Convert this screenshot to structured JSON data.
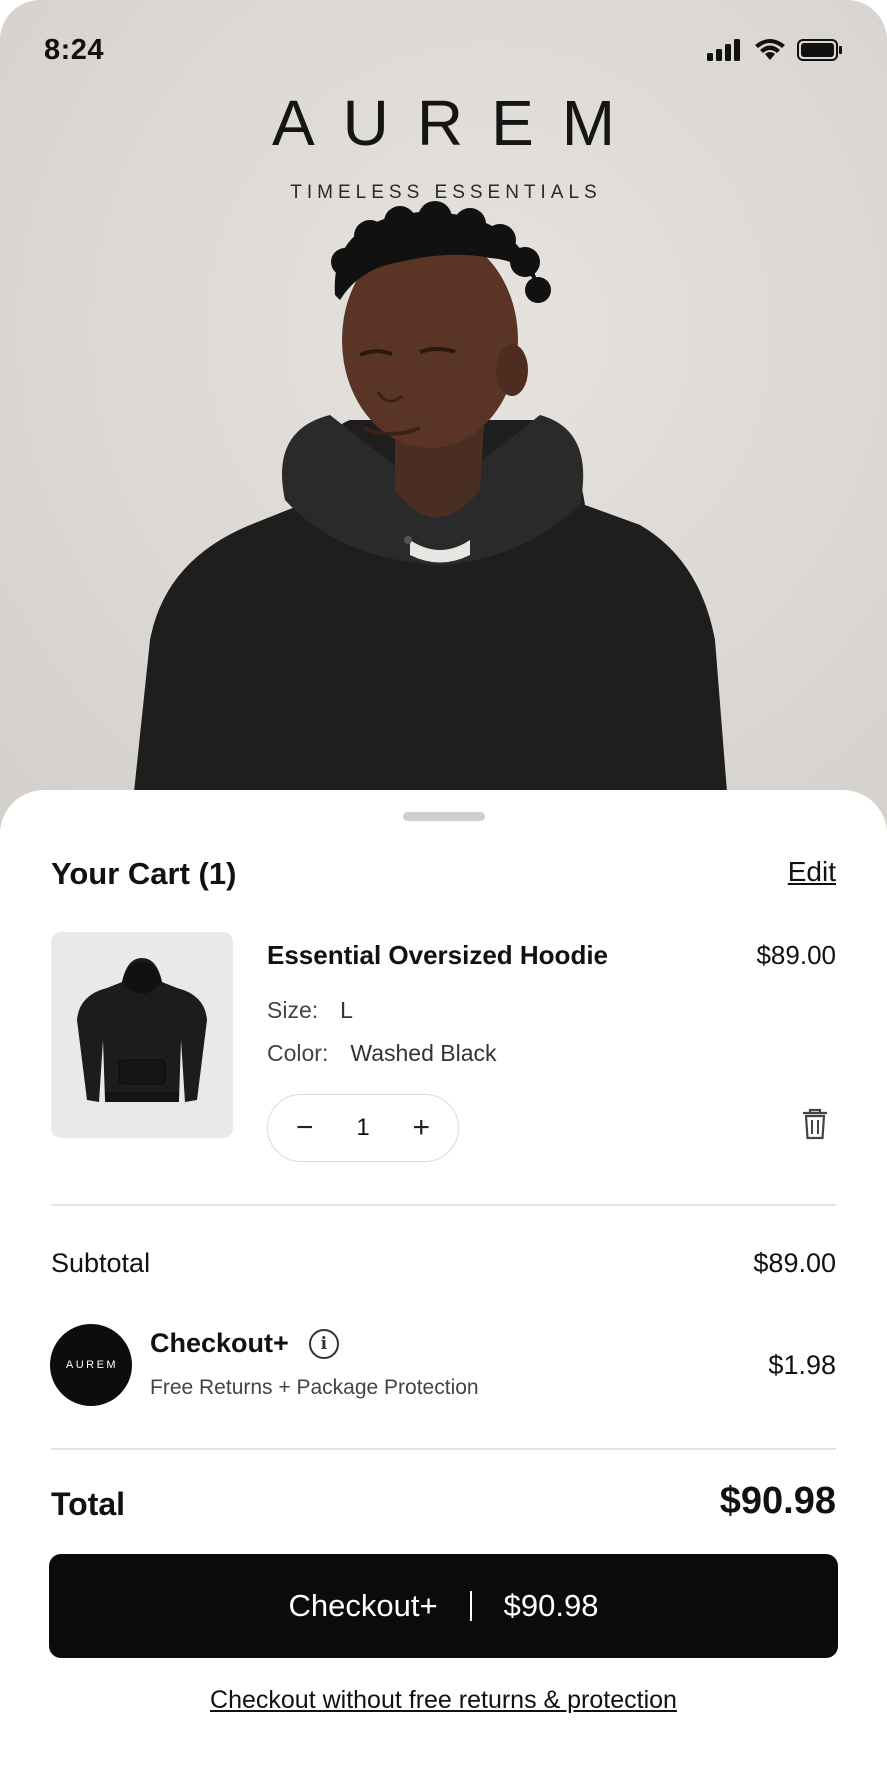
{
  "status_bar": {
    "time": "8:24",
    "icons": [
      "signal-icon",
      "wifi-icon",
      "battery-icon"
    ]
  },
  "hero": {
    "brand": "AUREM",
    "tagline": "TIMELESS ESSENTIALS"
  },
  "cart": {
    "title": "Your Cart (1)",
    "edit_label": "Edit",
    "item": {
      "name": "Essential Oversized Hoodie",
      "price": "$89.00",
      "size_label": "Size:",
      "size_value": "L",
      "color_label": "Color:",
      "color_value": "Washed Black",
      "quantity": "1",
      "decrement_symbol": "−",
      "increment_symbol": "+"
    },
    "subtotal_label": "Subtotal",
    "subtotal_value": "$89.00",
    "checkout_plus": {
      "badge_text": "AUREM",
      "title": "Checkout+",
      "info_symbol": "i",
      "description": "Free Returns + Package Protection",
      "price": "$1.98"
    },
    "total_label": "Total",
    "total_value": "$90.98",
    "cta": {
      "label": "Checkout+",
      "amount": "$90.98"
    },
    "alt_link": "Checkout without free returns & protection"
  },
  "colors": {
    "hero_bg": "#dcd8d4",
    "primary_button": "#0b0b0b",
    "text": "#111111"
  }
}
